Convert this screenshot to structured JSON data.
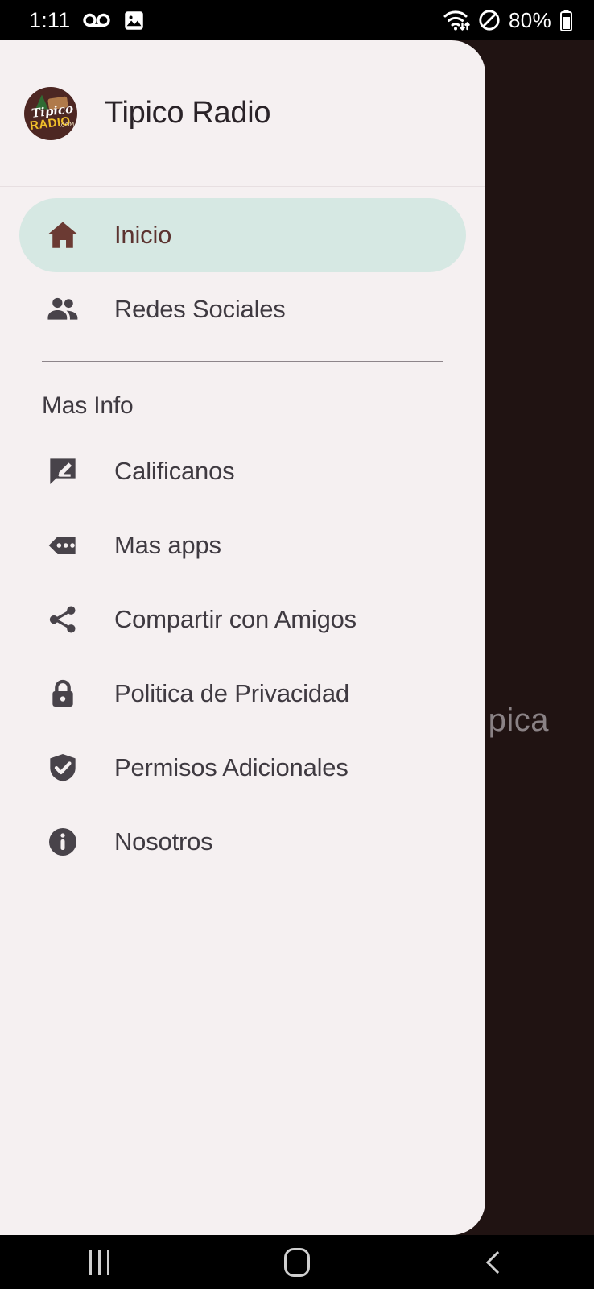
{
  "status_bar": {
    "clock": "1:11",
    "battery_text": "80%",
    "icons": [
      "voicemail-icon",
      "image-icon",
      "wifi-icon",
      "do-not-disturb-icon",
      "battery-icon"
    ]
  },
  "drawer": {
    "app_title": "Tipico Radio",
    "logo": {
      "brand_script": "Tipico",
      "brand_main": "RADIO",
      "brand_suffix": ".COM",
      "circle_color": "#4d2723",
      "radio_color": "#f0bf2a"
    },
    "primary_items": [
      {
        "label": "Inicio",
        "icon": "home-icon",
        "selected": true
      },
      {
        "label": "Redes Sociales",
        "icon": "people-icon",
        "selected": false
      }
    ],
    "section_label": "Mas Info",
    "info_items": [
      {
        "label": "Calificanos",
        "icon": "rate-review-icon"
      },
      {
        "label": "Mas apps",
        "icon": "more-apps-tag-icon"
      },
      {
        "label": "Compartir con Amigos",
        "icon": "share-icon"
      },
      {
        "label": "Politica de Privacidad",
        "icon": "lock-icon"
      },
      {
        "label": "Permisos Adicionales",
        "icon": "shield-check-icon"
      },
      {
        "label": "Nosotros",
        "icon": "info-icon"
      }
    ],
    "colors": {
      "surface": "#f5f0f1",
      "selected_pill": "#d6e8e3",
      "selected_text": "#5c3330",
      "item_text": "#3f3a41"
    }
  },
  "backdrop": {
    "visible_text": "pica",
    "color": "#201312"
  },
  "system_nav": {
    "recents_label": "Recents",
    "home_label": "Home",
    "back_label": "Back"
  }
}
